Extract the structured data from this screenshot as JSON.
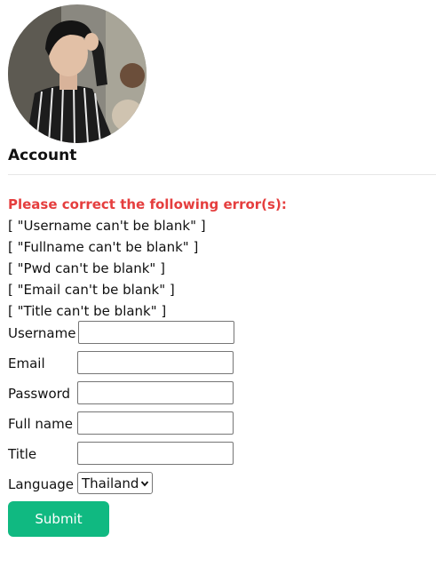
{
  "profile": {
    "avatar_description": "profile-photo",
    "heading": "Account"
  },
  "errors": {
    "title": "Please correct the following error(s):",
    "items": [
      "[ \"Username can't be blank\" ]",
      "[ \"Fullname can't be blank\" ]",
      "[ \"Pwd can't be blank\" ]",
      "[ \"Email can't be blank\" ]",
      "[ \"Title can't be blank\" ]"
    ],
    "color": "#e53e3e"
  },
  "form": {
    "username_label": "Username",
    "username_value": "",
    "email_label": "Email",
    "email_value": "",
    "password_label": "Password",
    "password_value": "",
    "fullname_label": "Full name",
    "fullname_value": "",
    "title_label": "Title",
    "title_value": "",
    "language_label": "Language",
    "language_selected": "Thailand",
    "submit_label": "Submit",
    "submit_color": "#10b981"
  }
}
